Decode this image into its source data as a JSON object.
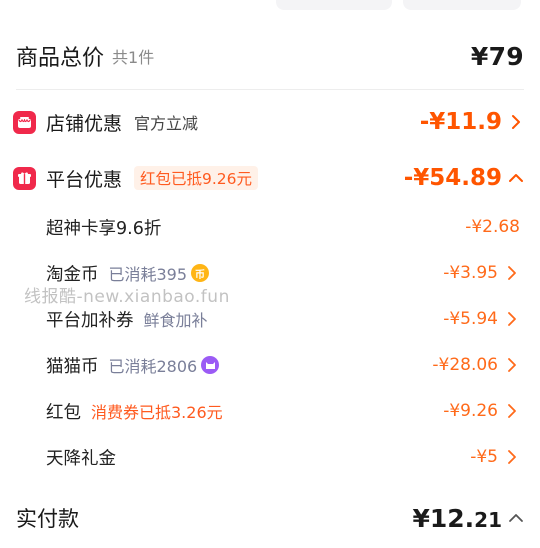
{
  "summary": {
    "total_label": "商品总价",
    "count_label": "共1件",
    "total_price": "¥79"
  },
  "shop_discount": {
    "title": "店铺优惠",
    "tag": "官方立减",
    "amount": "-¥11.9"
  },
  "platform_discount": {
    "title": "平台优惠",
    "tag": "红包已抵9.26元",
    "amount": "-¥54.89",
    "items": [
      {
        "title": "超神卡享9.6折",
        "note": "",
        "amount": "-¥2.68"
      },
      {
        "title": "淘金币",
        "note": "已消耗395",
        "icon": "gold-coin-icon",
        "amount": "-¥3.95"
      },
      {
        "title": "平台加补券",
        "note": "鲜食加补",
        "amount": "-¥5.94"
      },
      {
        "title": "猫猫币",
        "note": "已消耗2806",
        "icon": "cat-coin-icon",
        "amount": "-¥28.06"
      },
      {
        "title": "红包",
        "note": "消费券已抵3.26元",
        "amount": "-¥9.26"
      },
      {
        "title": "天降礼金",
        "note": "",
        "amount": "-¥5"
      }
    ]
  },
  "watermark": "线报酷-new.xianbao.fun",
  "payment": {
    "label": "实付款",
    "price_main": "¥12.",
    "price_dec": "21"
  },
  "colors": {
    "accent_orange": "#ff5500",
    "badge_red": "#f0294b"
  }
}
